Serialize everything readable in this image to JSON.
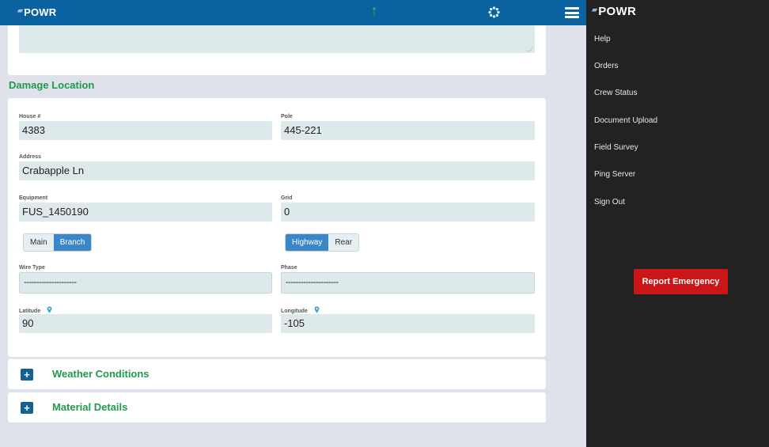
{
  "header": {
    "logo": "POWR",
    "icons": [
      "signal-icon",
      "spinner-icon",
      "hamburger-menu-icon"
    ]
  },
  "damage_location": {
    "title": "Damage Location",
    "fields": {
      "house": {
        "label": "House #",
        "value": "4383"
      },
      "pole": {
        "label": "Pole",
        "value": "445-221"
      },
      "address": {
        "label": "Address",
        "value": "Crabapple Ln"
      },
      "equipment": {
        "label": "Equipment",
        "value": "FUS_1450190"
      },
      "grid": {
        "label": "Grid",
        "value": "0"
      },
      "wire_type": {
        "label": "Wire Type",
        "value": "---------------------"
      },
      "phase": {
        "label": "Phase",
        "value": "---------------------"
      },
      "latitude": {
        "label": "Latitude",
        "value": "90"
      },
      "longitude": {
        "label": "Longitude",
        "value": "-105"
      }
    },
    "line_toggle": {
      "options": [
        "Main",
        "Branch"
      ],
      "selected": "Branch"
    },
    "access_toggle": {
      "options": [
        "Highway",
        "Rear"
      ],
      "selected": "Highway"
    }
  },
  "accordions": [
    {
      "title": "Weather Conditions",
      "expanded": false
    },
    {
      "title": "Material Details",
      "expanded": false
    }
  ],
  "side_menu": {
    "logo": "POWR",
    "items": [
      "Help",
      "Orders",
      "Crew Status",
      "Document Upload",
      "Field Survey",
      "Ping Server",
      "Sign Out"
    ],
    "emergency_button": "Report Emergency"
  },
  "colors": {
    "header_blue": "#0a62a0",
    "section_green": "#1f9a4a",
    "active_toggle": "#3a86c8",
    "emergency_red": "#cc1517",
    "menu_bg": "#222222"
  }
}
